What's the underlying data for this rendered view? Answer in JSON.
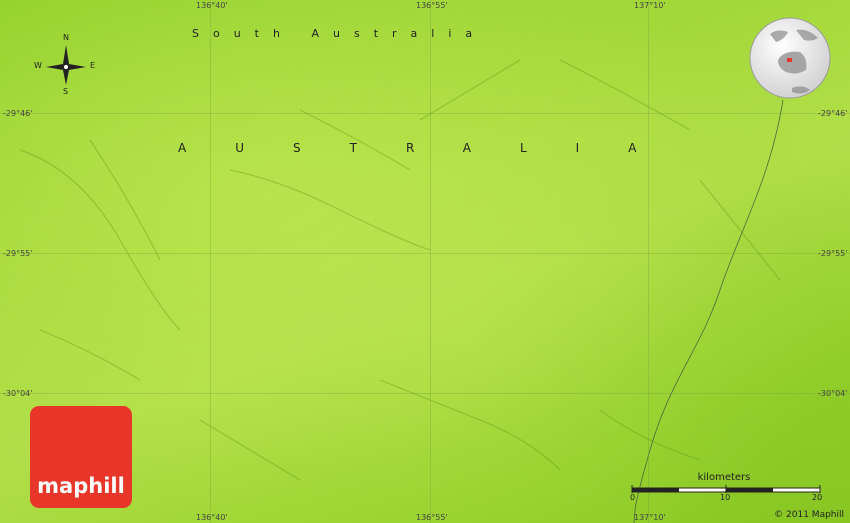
{
  "map": {
    "region_label": "South Australia",
    "country_label": "AUSTRALIA",
    "longitudes": [
      "136°40'",
      "136°55'",
      "137°10'"
    ],
    "latitudes": [
      "-29°46'",
      "-29°55'",
      "-30°04'"
    ],
    "compass": {
      "north": "N",
      "south": "S",
      "east": "E",
      "west": "W"
    },
    "scale": {
      "title": "kilometers",
      "ticks": [
        "0",
        "10",
        "20"
      ]
    },
    "logo_text": "maphill",
    "copyright": "© 2011 Maphill",
    "colors": {
      "terrain": "#9fd634",
      "logo": "#e8372a",
      "locator_marker": "#e8372a"
    }
  }
}
